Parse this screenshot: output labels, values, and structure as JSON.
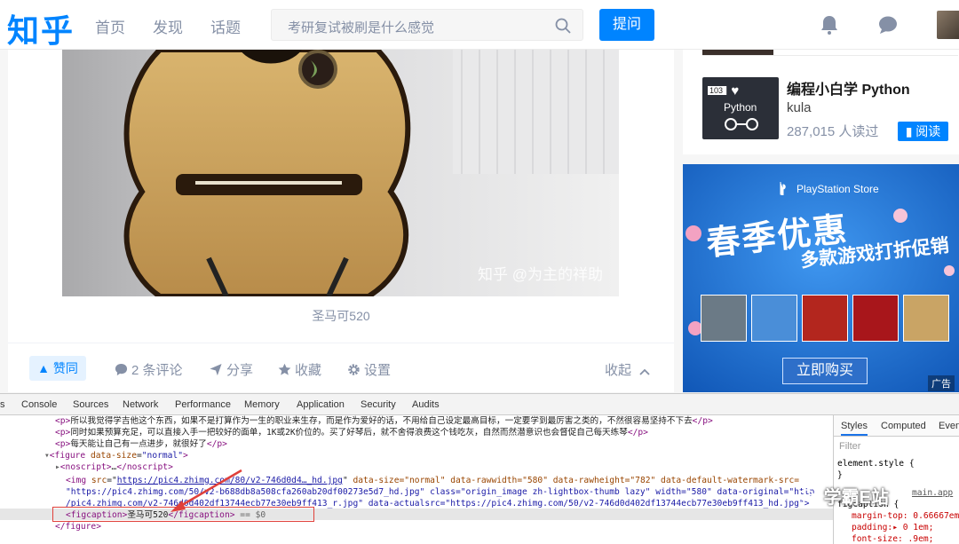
{
  "header": {
    "logo": "知乎",
    "nav": [
      "首页",
      "发现",
      "话题"
    ],
    "search_placeholder": "考研复试被刷是什么感觉",
    "ask_label": "提问"
  },
  "content": {
    "watermark": "知乎 @为主的祥助",
    "caption": "圣马可520",
    "actions": {
      "vote": "▲ 赞同",
      "comments": "2 条评论",
      "share": "分享",
      "favorite": "收藏",
      "settings": "设置",
      "collapse": "收起"
    }
  },
  "sidebar": {
    "book_title": "编程小白学 Python",
    "book_author": "kula",
    "book_reads": "287,015 人读过",
    "read_label": "阅读",
    "cover_text": [
      "103",
      "I ♥",
      "Python"
    ]
  },
  "ad": {
    "brand": "PlayStation Store",
    "title": "春季优惠",
    "subtitle": "多款游戏打折促销",
    "buy_label": "立即购买",
    "tag": "广告"
  },
  "devtools": {
    "tabs": [
      "s",
      "Console",
      "Sources",
      "Network",
      "Performance",
      "Memory",
      "Application",
      "Security",
      "Audits"
    ],
    "side_tabs": [
      "Styles",
      "Computed",
      "Event"
    ],
    "filter_placeholder": "Filter",
    "code": {
      "p1_text": "所以我觉得学吉他这个东西，如果不是打算作为一生的职业来生存，而是作为爱好的话，不用给自己设定最高目标，一定要学到最厉害之类的，不然很容易坚持不下去",
      "p2_text": "同时如果预算充足，可以直接入手一把较好的面单，1K或2K价位的。买了好琴后，就不舍得浪费这个钱吃灰，自然而然潜意识也会督促自己每天练琴",
      "p3_text": "每天能让自己有一点进步，就很好了",
      "figure_attr": "data-size",
      "figure_val": "\"normal\"",
      "noscript": "…",
      "img_src": "https://pic4.zhimg.com/80/v2-746d0d4…_hd.jpg",
      "img_rest1": "data-size=\"normal\" data-rawwidth=\"580\" data-rawheight=\"782\" data-default-watermark-src=",
      "img_line2_pre": "\"https://pic4.zhimg.com/50/v2-b688db8a508cfa260ab20df00273e5d7_hd.jpg\" class=\"origin_image zh-lightbox-thumb lazy\" width=\"580\" data-original=\"http",
      "img_line3": "/pic4.zhimg.com/v2-746d0d402df13744ecb77e30eb9ff413_r.jpg\" data-actualsrc=\"https://pic4.zhimg.com/50/v2-746d0d402df13744ecb77e30eb9ff413_hd.jpg\">",
      "figcaption_text": "圣马可520",
      "eq": "== $0"
    },
    "styles": {
      "element_style": "element.style {",
      "close": "}",
      "source": "main.app",
      "rule": "figcaption {",
      "margin_top": "margin-top: 0.66667em",
      "padding": "padding:▸ 0 1em;",
      "font_size": "font-size: .9em;"
    }
  },
  "overlay": {
    "wechat_watermark": "学霸E站"
  },
  "colors": {
    "brand_blue": "#0084ff",
    "muted": "#8590a6",
    "highlight_box": "#e0403a"
  }
}
